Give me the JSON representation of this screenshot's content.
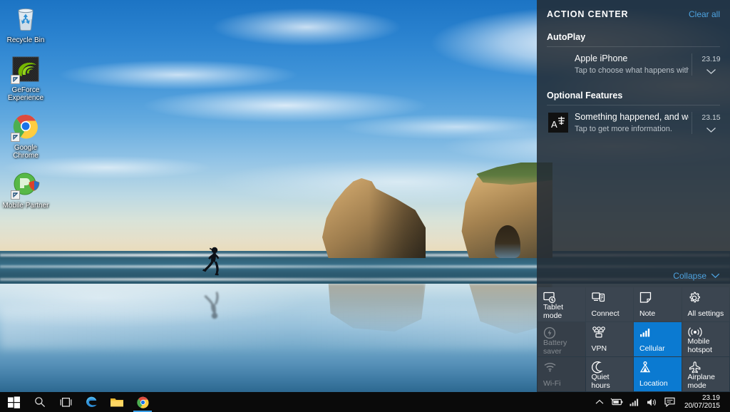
{
  "desktop": {
    "icons": [
      {
        "label": "Recycle Bin",
        "icon": "recycle-bin-icon",
        "shortcut": false
      },
      {
        "label": "GeForce Experience",
        "icon": "geforce-experience-icon",
        "shortcut": true
      },
      {
        "label": "Google Chrome",
        "icon": "google-chrome-icon",
        "shortcut": true
      },
      {
        "label": "Mobile Partner",
        "icon": "mobile-partner-icon",
        "shortcut": true
      }
    ]
  },
  "action_center": {
    "title": "ACTION CENTER",
    "clear_all": "Clear all",
    "collapse": "Collapse",
    "groups": [
      {
        "name": "AutoPlay",
        "notifications": [
          {
            "icon": "blank-icon",
            "title": "Apple iPhone",
            "subtitle": "Tap to choose what happens with this de",
            "time": "23.19"
          }
        ]
      },
      {
        "name": "Optional Features",
        "notifications": [
          {
            "icon": "language-translate-icon",
            "title": "Something happened, and we coulc",
            "subtitle": "Tap to get more information.",
            "time": "23.15"
          }
        ]
      }
    ],
    "tiles": [
      {
        "label": "Tablet mode",
        "icon": "tablet-mode-icon",
        "state": "normal"
      },
      {
        "label": "Connect",
        "icon": "connect-icon",
        "state": "normal"
      },
      {
        "label": "Note",
        "icon": "note-icon",
        "state": "normal"
      },
      {
        "label": "All settings",
        "icon": "gear-icon",
        "state": "normal"
      },
      {
        "label": "Battery saver",
        "icon": "battery-saver-icon",
        "state": "disabled"
      },
      {
        "label": "VPN",
        "icon": "vpn-icon",
        "state": "normal"
      },
      {
        "label": "Cellular",
        "icon": "cellular-icon",
        "state": "on"
      },
      {
        "label": "Mobile hotspot",
        "icon": "mobile-hotspot-icon",
        "state": "normal"
      },
      {
        "label": "Wi-Fi",
        "icon": "wifi-icon",
        "state": "disabled"
      },
      {
        "label": "Quiet hours",
        "icon": "moon-icon",
        "state": "normal"
      },
      {
        "label": "Location",
        "icon": "location-icon",
        "state": "on"
      },
      {
        "label": "Airplane mode",
        "icon": "airplane-icon",
        "state": "normal"
      }
    ]
  },
  "taskbar": {
    "buttons": [
      {
        "name": "start-button",
        "icon": "windows-logo-icon",
        "active": false
      },
      {
        "name": "search-button",
        "icon": "search-icon",
        "active": false
      },
      {
        "name": "task-view-button",
        "icon": "task-view-icon",
        "active": false
      },
      {
        "name": "edge-button",
        "icon": "edge-icon",
        "active": false
      },
      {
        "name": "file-explorer-button",
        "icon": "folder-icon",
        "active": false
      },
      {
        "name": "chrome-button",
        "icon": "chrome-icon",
        "active": true
      }
    ],
    "tray": [
      {
        "name": "show-hidden-icons",
        "icon": "chevron-up-icon"
      },
      {
        "name": "battery-tray-icon",
        "icon": "battery-icon"
      },
      {
        "name": "network-tray-icon",
        "icon": "signal-bars-icon"
      },
      {
        "name": "volume-tray-icon",
        "icon": "speaker-icon"
      },
      {
        "name": "action-center-tray-icon",
        "icon": "speech-bubble-icon"
      }
    ],
    "clock": {
      "time": "23.19",
      "date": "20/07/2015"
    }
  },
  "colors": {
    "accent": "#0b7ad1",
    "link": "#4ea3e0",
    "panel": "#232c35",
    "tile": "#3b4550",
    "taskbar": "#0a0a0a"
  }
}
